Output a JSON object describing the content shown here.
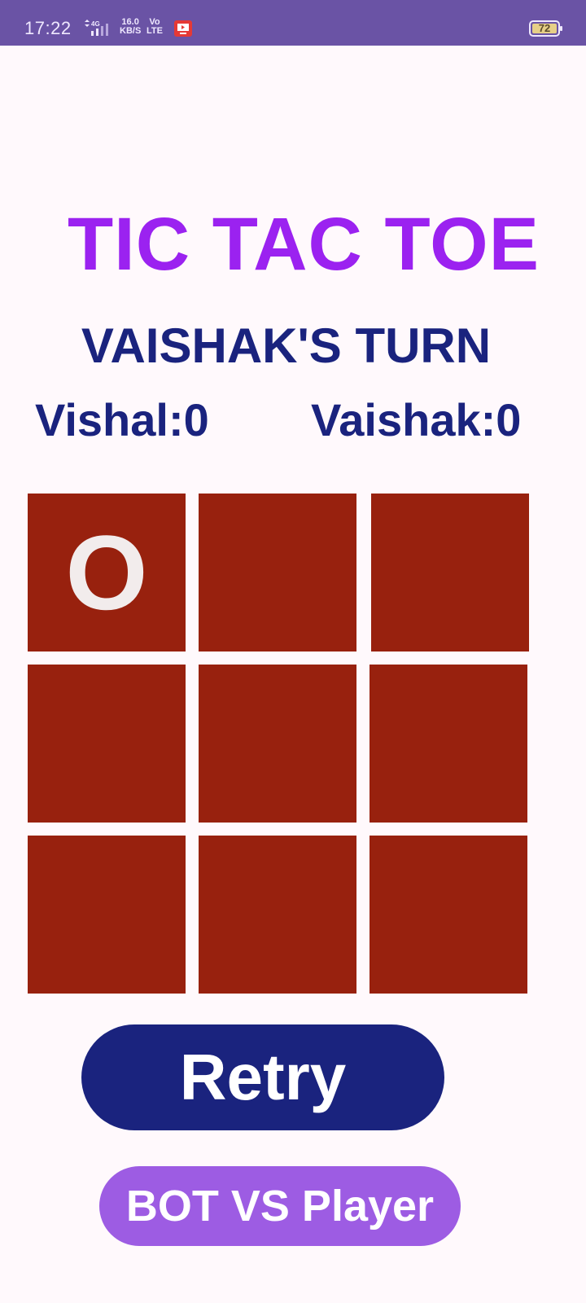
{
  "status_bar": {
    "time": "17:22",
    "network_speed_value": "16.0",
    "network_speed_unit": "KB/S",
    "volte_top": "Vo",
    "volte_bottom": "LTE",
    "battery_level": "72",
    "signal_label": "4G",
    "icons": [
      "signal-icon",
      "tv-icon",
      "battery-icon"
    ]
  },
  "game": {
    "title": "TIC TAC TOE",
    "turn_text": "VAISHAK'S TURN",
    "player1_score": "Vishal:0",
    "player2_score": "Vaishak:0",
    "board": [
      "O",
      "",
      "",
      "",
      "",
      "",
      "",
      "",
      ""
    ]
  },
  "actions": {
    "retry_label": "Retry",
    "bot_mode_label": "BOT VS Player"
  },
  "colors": {
    "status_bar_bg": "#6A53A5",
    "title": "#9B22F0",
    "text_primary": "#1A237E",
    "cell_bg": "#98210E",
    "cell_mark": "#F2ECEC",
    "retry_bg": "#1A237E",
    "bot_bg": "#9D5CE3"
  }
}
